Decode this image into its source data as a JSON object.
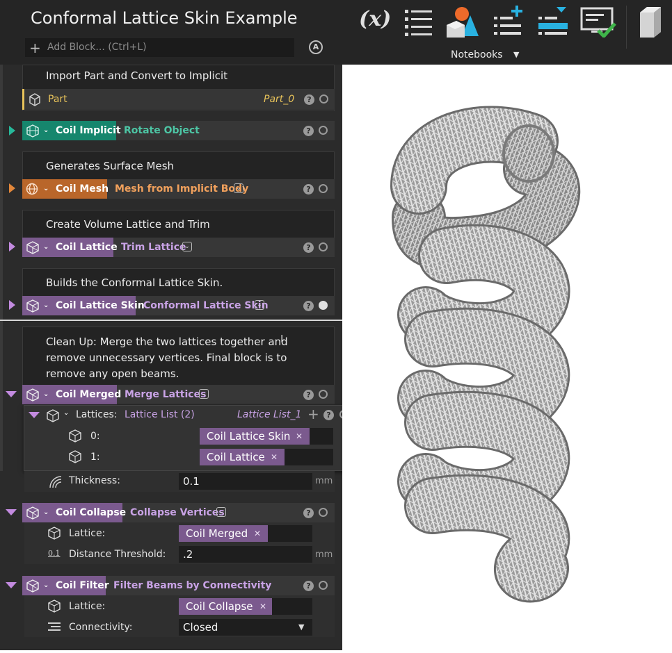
{
  "app": {
    "title": "Conformal Lattice Skin Example",
    "add_block_placeholder": "Add Block... (Ctrl+L)"
  },
  "toolbar": {
    "notebooks_label": "Notebooks",
    "icons": [
      "variable-x-icon",
      "list-icon",
      "shapes-icon",
      "add-list-icon",
      "download-list-icon",
      "monitor-check-icon",
      "part-box-icon"
    ]
  },
  "colors": {
    "implicit": "#16866d",
    "mesh": "#b9662a",
    "lattice": "#7b5a8e",
    "part_yellow": "#e8c35a",
    "fn_purple": "#c9a3e6",
    "fn_teal": "#4dc6a5",
    "fn_orange": "#f0a05c"
  },
  "blocks": {
    "import": {
      "comment": "Import Part and Convert to Implicit",
      "name": "Part",
      "value": "Part_0"
    },
    "implicit": {
      "name": "Coil Implicit",
      "function": "Rotate Object"
    },
    "mesh": {
      "comment": "Generates Surface Mesh",
      "name": "Coil Mesh",
      "function": "Mesh from Implicit Body"
    },
    "lattice": {
      "comment": "Create Volume Lattice and Trim",
      "name": "Coil Lattice",
      "function": "Trim Lattice"
    },
    "skin": {
      "comment": "Builds the Conformal Lattice Skin.",
      "name": "Coil Lattice Skin",
      "function": "Conformal Lattice Skin"
    },
    "merged": {
      "comment_lines": [
        "Clean Up: Merge the two lattices together and",
        "remove unnecessary vertices. Final block is to",
        "remove any open beams."
      ],
      "name": "Coil Merged",
      "function": "Merge Lattices",
      "lattices_label": "Lattices:",
      "lattices_fn": "Lattice List (2)",
      "lattices_value": "Lattice List_1",
      "items": [
        {
          "index": "0:",
          "value": "Coil Lattice Skin"
        },
        {
          "index": "1:",
          "value": "Coil Lattice"
        }
      ],
      "thickness_label": "Thickness:",
      "thickness_value": "0.1",
      "thickness_unit": "mm"
    },
    "collapse": {
      "name": "Coil Collapse",
      "function": "Collapse Vertices",
      "lattice_label": "Lattice:",
      "lattice_value": "Coil Merged",
      "threshold_label": "Distance Threshold:",
      "threshold_value": ".2",
      "threshold_unit": "mm",
      "threshold_icon_text": "0.1"
    },
    "filter": {
      "name": "Coil Filter",
      "function": "Filter Beams by Connectivity",
      "lattice_label": "Lattice:",
      "lattice_value": "Coil Collapse",
      "connectivity_label": "Connectivity:",
      "connectivity_value": "Closed"
    }
  },
  "viewport": {
    "content": "coil-lattice-render"
  }
}
